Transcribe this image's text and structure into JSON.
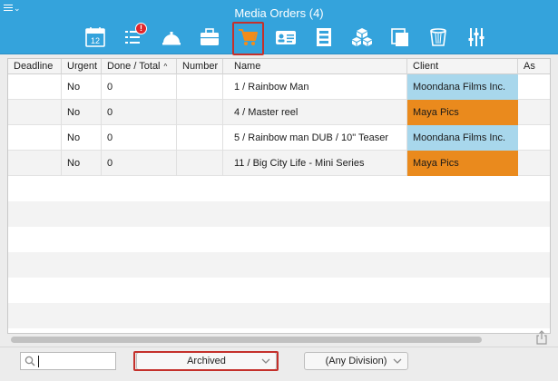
{
  "window": {
    "title": "Media Orders (4)"
  },
  "toolbar": {
    "selected": "cart",
    "alert_badge": "!",
    "calendar_day": "12",
    "items": [
      {
        "id": "calendar",
        "icon": "calendar-icon"
      },
      {
        "id": "tasks",
        "icon": "task-list-icon"
      },
      {
        "id": "service",
        "icon": "service-bell-icon"
      },
      {
        "id": "jobs",
        "icon": "briefcase-icon"
      },
      {
        "id": "cart",
        "icon": "shopping-cart-icon"
      },
      {
        "id": "contacts",
        "icon": "contact-card-icon"
      },
      {
        "id": "media",
        "icon": "film-strip-icon"
      },
      {
        "id": "inventory",
        "icon": "boxes-icon"
      },
      {
        "id": "copies",
        "icon": "copy-icon"
      },
      {
        "id": "trash",
        "icon": "trash-icon"
      },
      {
        "id": "settings",
        "icon": "sliders-icon"
      }
    ]
  },
  "table": {
    "columns": [
      "Deadline",
      "Urgent",
      "Done / Total",
      "Number",
      "Name",
      "Client",
      "As"
    ],
    "sort_indicator": "^",
    "rows": [
      {
        "deadline": "",
        "urgent": "No",
        "done_total": "0",
        "number": "",
        "name": "1 / Rainbow Man",
        "client": "Moondana Films Inc.",
        "client_color": "#a8d7ec"
      },
      {
        "deadline": "",
        "urgent": "No",
        "done_total": "0",
        "number": "",
        "name": "4 / Master reel",
        "client": "Maya Pics",
        "client_color": "#ea8a1d"
      },
      {
        "deadline": "",
        "urgent": "No",
        "done_total": "0",
        "number": "",
        "name": "5 / Rainbow man DUB / 10\" Teaser",
        "client": "Moondana Films Inc.",
        "client_color": "#a8d7ec"
      },
      {
        "deadline": "",
        "urgent": "No",
        "done_total": "0",
        "number": "",
        "name": "11 / Big City Life - Mini Series",
        "client": "Maya Pics",
        "client_color": "#ea8a1d"
      }
    ]
  },
  "footer": {
    "search_value": "",
    "status_filter": "Archived",
    "division_filter": "(Any Division)"
  },
  "colors": {
    "titlebar": "#34a3dc",
    "highlight_frame": "#c4302b",
    "row_alt": "#f3f3f3"
  }
}
